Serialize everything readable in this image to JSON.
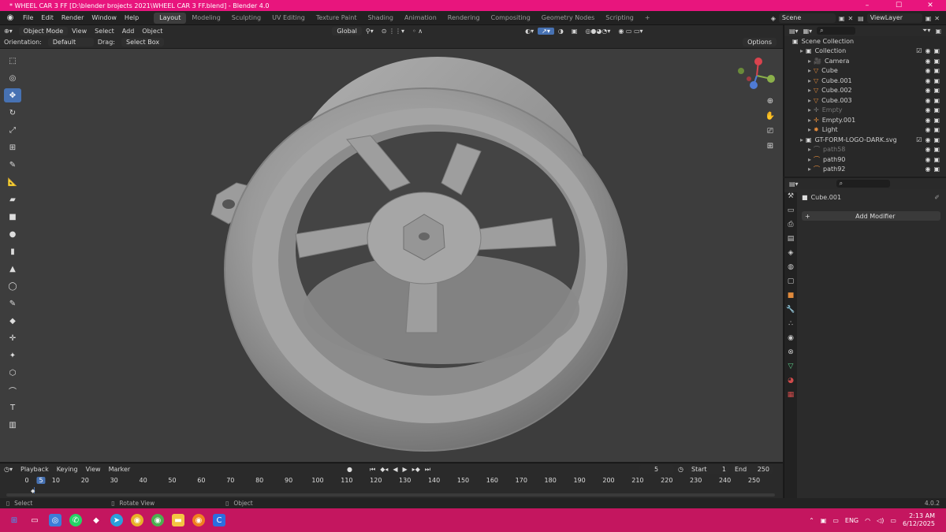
{
  "window": {
    "title": "* WHEEL CAR 3 FF [D:\\blender brojects 2021\\WHEEL CAR 3 FF.blend] - Blender 4.0",
    "controls": [
      "–",
      "☐",
      "✕"
    ]
  },
  "menubar": {
    "items": [
      "File",
      "Edit",
      "Render",
      "Window",
      "Help"
    ],
    "workspaces": [
      "Layout",
      "Modeling",
      "Sculpting",
      "UV Editing",
      "Texture Paint",
      "Shading",
      "Animation",
      "Rendering",
      "Compositing",
      "Geometry Nodes",
      "Scripting"
    ],
    "active_workspace": "Layout",
    "add_tab": "+",
    "scene": "Scene",
    "view_layer": "ViewLayer"
  },
  "viewport_header": {
    "mode": "Object Mode",
    "menus": [
      "View",
      "Select",
      "Add",
      "Object"
    ],
    "transform_orientation": "Global",
    "orientation_label": "Orientation:",
    "orientation_value": "Default",
    "drag_label": "Drag:",
    "drag_value": "Select Box",
    "options": "Options"
  },
  "toolbar": {
    "tools": [
      "select-box-icon",
      "cursor-icon",
      "move-icon",
      "rotate-icon",
      "scale-icon",
      "transform-icon",
      "annotate-icon",
      "measure-icon",
      "add-cube-icon",
      "add-cone-icon",
      "add-uv-sphere-icon",
      "add-cylinder-icon",
      "add-cone2-icon",
      "add-torus-icon",
      "add-grease-icon",
      "add-monkey-icon",
      "add-empty-icon",
      "add-light-icon",
      "add-camera-icon",
      "add-text-icon",
      "add-image-icon",
      "add-speaker-icon"
    ],
    "active_index": 2
  },
  "outliner": {
    "root": "Scene Collection",
    "rows": [
      {
        "name": "Collection",
        "indent": 1,
        "kind": "collection",
        "dim": false,
        "sel": false
      },
      {
        "name": "Camera",
        "indent": 2,
        "kind": "camera",
        "dim": false,
        "sel": false
      },
      {
        "name": "Cube",
        "indent": 2,
        "kind": "mesh",
        "dim": false,
        "sel": false
      },
      {
        "name": "Cube.001",
        "indent": 2,
        "kind": "mesh",
        "dim": false,
        "sel": false
      },
      {
        "name": "Cube.002",
        "indent": 2,
        "kind": "mesh",
        "dim": false,
        "sel": false
      },
      {
        "name": "Cube.003",
        "indent": 2,
        "kind": "mesh",
        "dim": false,
        "sel": false
      },
      {
        "name": "Empty",
        "indent": 2,
        "kind": "empty",
        "dim": true,
        "sel": false
      },
      {
        "name": "Empty.001",
        "indent": 2,
        "kind": "empty",
        "dim": false,
        "sel": false
      },
      {
        "name": "Light",
        "indent": 2,
        "kind": "light",
        "dim": false,
        "sel": false
      },
      {
        "name": "GT-FORM-LOGO-DARK.svg",
        "indent": 1,
        "kind": "collection",
        "dim": false,
        "sel": false
      },
      {
        "name": "path58",
        "indent": 2,
        "kind": "curve",
        "dim": true,
        "sel": false
      },
      {
        "name": "path90",
        "indent": 2,
        "kind": "curve",
        "dim": false,
        "sel": false
      },
      {
        "name": "path92",
        "indent": 2,
        "kind": "curve",
        "dim": false,
        "sel": false
      }
    ]
  },
  "properties": {
    "object_name": "Cube.001",
    "add_modifier": "Add Modifier"
  },
  "timeline": {
    "menus": [
      "Playback",
      "Keying",
      "View",
      "Marker"
    ],
    "current_frame": "5",
    "start_label": "Start",
    "start_value": "1",
    "end_label": "End",
    "end_value": "250",
    "ticks": [
      "0",
      "10",
      "20",
      "30",
      "40",
      "50",
      "60",
      "70",
      "80",
      "90",
      "100",
      "110",
      "120",
      "130",
      "140",
      "150",
      "160",
      "170",
      "180",
      "190",
      "200",
      "210",
      "220",
      "230",
      "240",
      "250"
    ],
    "ruler_current": "5"
  },
  "statusbar": {
    "select": "Select",
    "rotate": "Rotate View",
    "object": "Object",
    "version": "4.0.2"
  },
  "taskbar": {
    "lang": "ENG",
    "time": "2:13 AM",
    "date": "6/12/2025"
  }
}
